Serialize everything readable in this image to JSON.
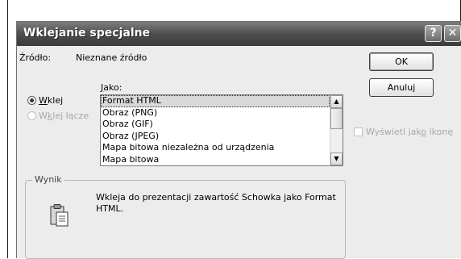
{
  "dialog": {
    "title": "Wklejanie specjalne",
    "help_button": "?",
    "close_button": "✕"
  },
  "source": {
    "label": "Źródło:",
    "value": "Nieznane źródło"
  },
  "buttons": {
    "ok": "OK",
    "cancel": "Anuluj"
  },
  "as_label": {
    "first": "J",
    "rest": "ako:"
  },
  "options": {
    "paste": {
      "first": "W",
      "rest": "klej",
      "checked": true
    },
    "paste_link": {
      "pre": "W",
      "u": "k",
      "rest": "lej łącze",
      "enabled": false
    }
  },
  "formats": {
    "items": [
      "Format HTML",
      "Obraz (PNG)",
      "Obraz (GIF)",
      "Obraz (JPEG)",
      "Mapa bitowa niezależna od urządzenia",
      "Mapa bitowa"
    ],
    "selected": "Format HTML"
  },
  "display_as_icon": {
    "pre": "Wyświetl jak",
    "u": "o",
    "rest": " ikonę",
    "checked": false,
    "enabled": false
  },
  "result": {
    "legend": "Wynik",
    "text": "Wkleja do prezentacji zawartość Schowka jako Format HTML."
  }
}
